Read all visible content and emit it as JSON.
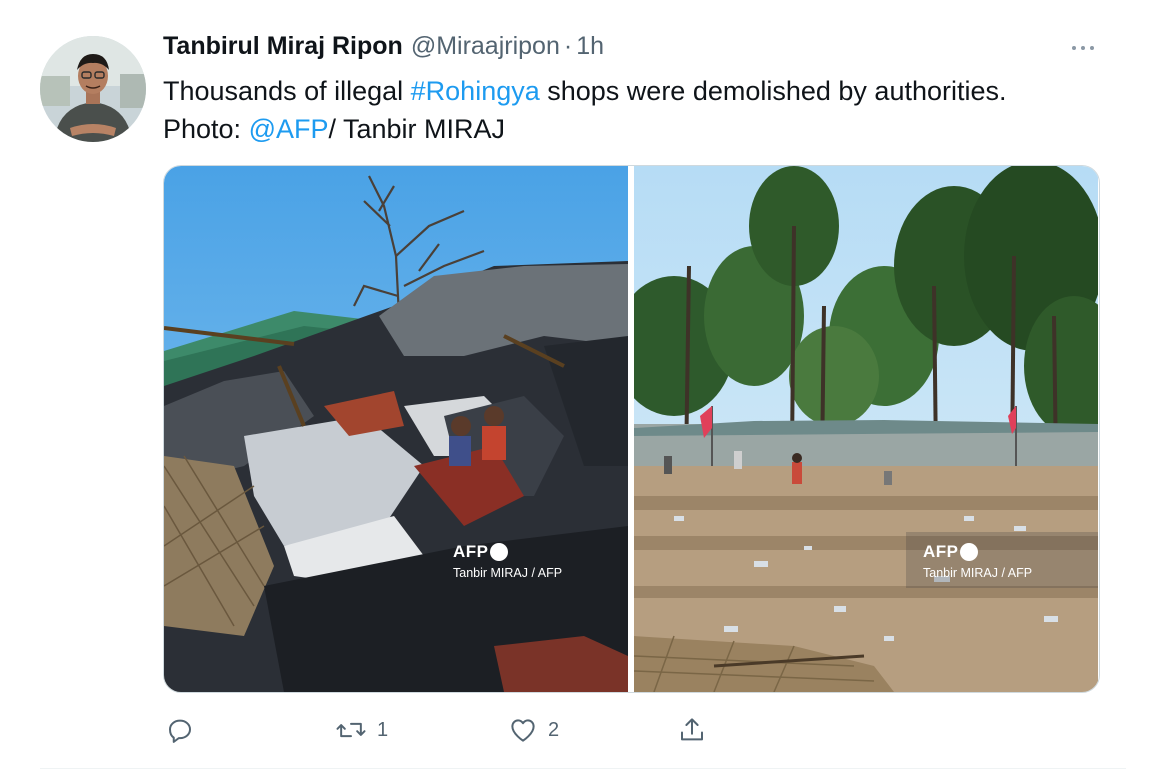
{
  "tweet": {
    "author_name": "Tanbirul Miraj Ripon",
    "handle": "@Miraajripon",
    "separator": "·",
    "time": "1h",
    "text_part1": "Thousands of illegal ",
    "hashtag": "#Rohingya",
    "text_part2": " shops were demolished by authorities.",
    "text_part3": "Photo: ",
    "mention": "@AFP",
    "text_part4": "/ Tanbir MIRAJ"
  },
  "media": {
    "photo1": {
      "logo": "AFP",
      "credit": "Tanbir MIRAJ / AFP"
    },
    "photo2": {
      "logo": "AFP",
      "credit": "Tanbir MIRAJ / AFP"
    }
  },
  "actions": {
    "reply": {
      "icon": "reply-icon",
      "count": ""
    },
    "retweet": {
      "icon": "retweet-icon",
      "count": "1"
    },
    "like": {
      "icon": "heart-icon",
      "count": "2"
    },
    "share": {
      "icon": "share-icon",
      "count": ""
    }
  },
  "colors": {
    "accent": "#1d9bf0",
    "secondary_text": "#536471",
    "border": "#cfd9de"
  }
}
